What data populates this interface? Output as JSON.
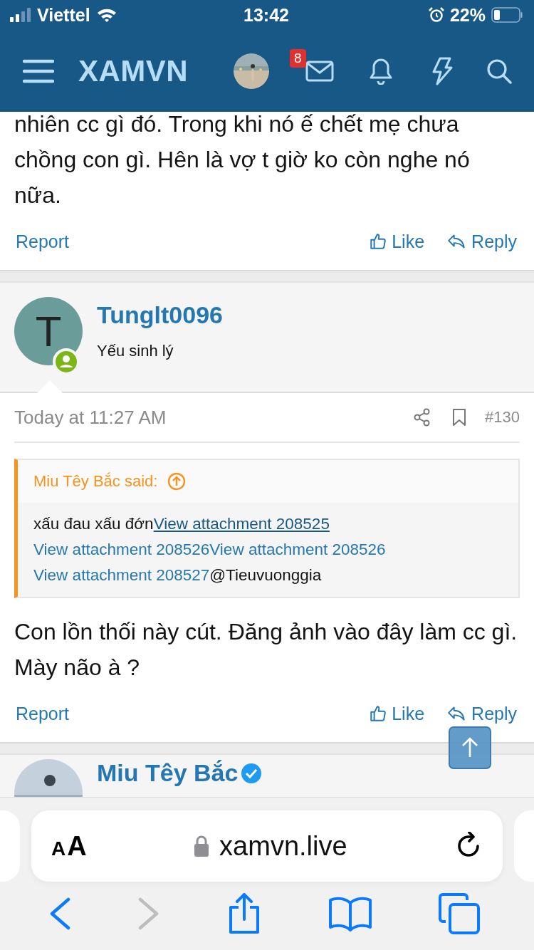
{
  "status_bar": {
    "carrier": "Viettel",
    "time": "13:42",
    "battery": "22%"
  },
  "header": {
    "logo": "XAMVN",
    "icons": [
      {
        "kind": "mail",
        "badge": "8"
      },
      {
        "kind": "bell"
      },
      {
        "kind": "bolt"
      },
      {
        "kind": "search"
      }
    ]
  },
  "posts": [
    {
      "kind": "continued",
      "body": "nhiên cc gì đó. Trong khi nó ế chết mẹ chưa chồng con gì. Hên là vợ t giờ ko còn nghe nó nữa.",
      "actions": {
        "report": "Report",
        "like": "Like",
        "reply": "Reply"
      }
    },
    {
      "kind": "full",
      "user": {
        "initial": "T",
        "name": "Tunglt0096",
        "title": "Yếu sinh lý",
        "online": true
      },
      "date": "Today at 11:27 AM",
      "number": "#130",
      "quote": {
        "author": "Miu Têy Bắc said:",
        "segments": [
          {
            "kind": "text",
            "text": "xấu đau xấu đớn"
          },
          {
            "kind": "link",
            "text": "View attachment 208525",
            "underlined": true
          },
          {
            "kind": "link",
            "text": "View attachment 208526",
            "underlined": false
          },
          {
            "kind": "link",
            "text": "View attachment 208526",
            "underlined": false
          },
          {
            "kind": "link",
            "text": "View attachment 208527",
            "underlined": false
          },
          {
            "kind": "text",
            "text": "@Tieuvuonggia"
          }
        ]
      },
      "body": "Con lồn thối này cút. Đăng ảnh vào đây làm cc gì. Mày não à ?",
      "actions": {
        "report": "Report",
        "like": "Like",
        "reply": "Reply"
      }
    },
    {
      "kind": "next",
      "user": {
        "name": "Miu Têy Bắc",
        "verified": true
      }
    }
  ],
  "browser": {
    "reader_small": "A",
    "reader_large": "A",
    "url": "xamvn.live",
    "secure": true,
    "toolbar": [
      {
        "kind": "back",
        "disabled": false
      },
      {
        "kind": "forward",
        "disabled": true
      },
      {
        "kind": "share",
        "disabled": false
      },
      {
        "kind": "bookmarks",
        "disabled": false
      },
      {
        "kind": "tabs",
        "disabled": false
      }
    ]
  }
}
